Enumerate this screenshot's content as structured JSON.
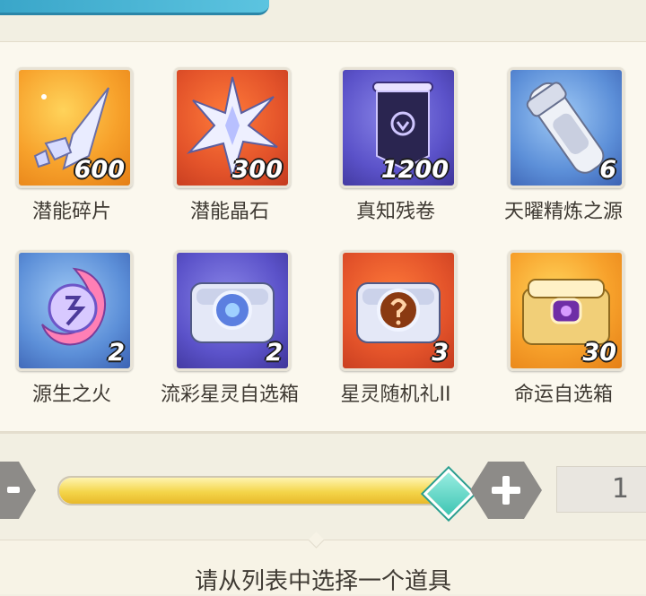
{
  "items": [
    {
      "name": "潜能碎片",
      "count": "600",
      "icon": "shard-icon",
      "bg": "orange"
    },
    {
      "name": "潜能晶石",
      "count": "300",
      "icon": "crystal-star-icon",
      "bg": "red"
    },
    {
      "name": "真知残卷",
      "count": "1200",
      "icon": "scroll-banner-icon",
      "bg": "purple"
    },
    {
      "name": "天曜精炼之源",
      "count": "6",
      "icon": "refine-tube-icon",
      "bg": "blue"
    },
    {
      "name": "源生之火",
      "count": "2",
      "icon": "swirl-flame-icon",
      "bg": "blue"
    },
    {
      "name": "流彩星灵自选箱",
      "count": "2",
      "icon": "chest-orb-icon",
      "bg": "purple"
    },
    {
      "name": "星灵随机礼II",
      "count": "3",
      "icon": "chest-question-icon",
      "bg": "red"
    },
    {
      "name": "命运自选箱",
      "count": "30",
      "icon": "golden-chest-icon",
      "bg": "orange"
    }
  ],
  "quantity": {
    "value": "1",
    "slider_fraction": 0.98
  },
  "hint": "请从列表中选择一个道具",
  "colors": {
    "accent": "#3fc5b3",
    "slider_fill": "#f4d54a"
  }
}
